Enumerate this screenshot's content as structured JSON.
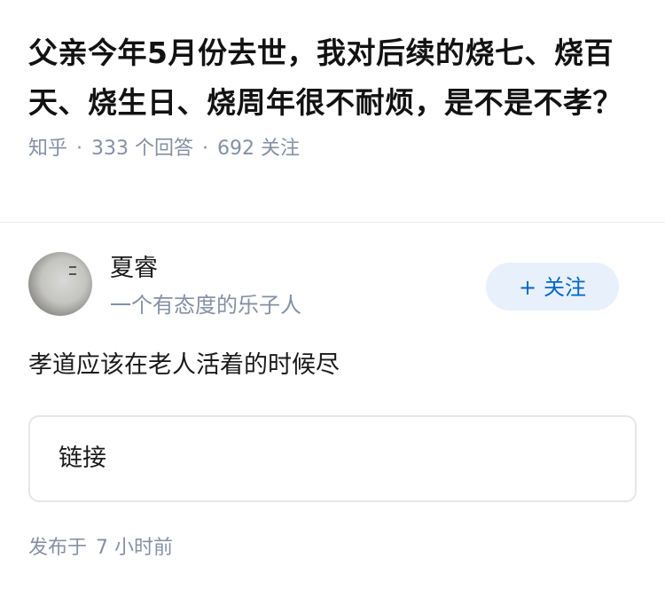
{
  "question": {
    "title": "父亲今年5月份去世，我对后续的烧七、烧百天、烧生日、烧周年很不耐烦，是不是不孝？",
    "source": "知乎",
    "separator": "·",
    "answers_count": "333",
    "answers_label": "个回答",
    "followers_count": "692",
    "followers_label": "关注"
  },
  "answer": {
    "author": {
      "name": "夏睿",
      "bio": "一个有态度的乐子人",
      "avatar_icon": "avatar-photo"
    },
    "follow_button": {
      "plus": "+",
      "label": "关注"
    },
    "content": "孝道应该在老人活着的时候尽",
    "link_card_label": "链接",
    "published_prefix": "发布于",
    "published_time": "7 小时前"
  },
  "colors": {
    "accent": "#0066cc",
    "follow_bg": "#e8f1fb",
    "meta_text": "#8590a6",
    "divider": "#ebebeb"
  }
}
